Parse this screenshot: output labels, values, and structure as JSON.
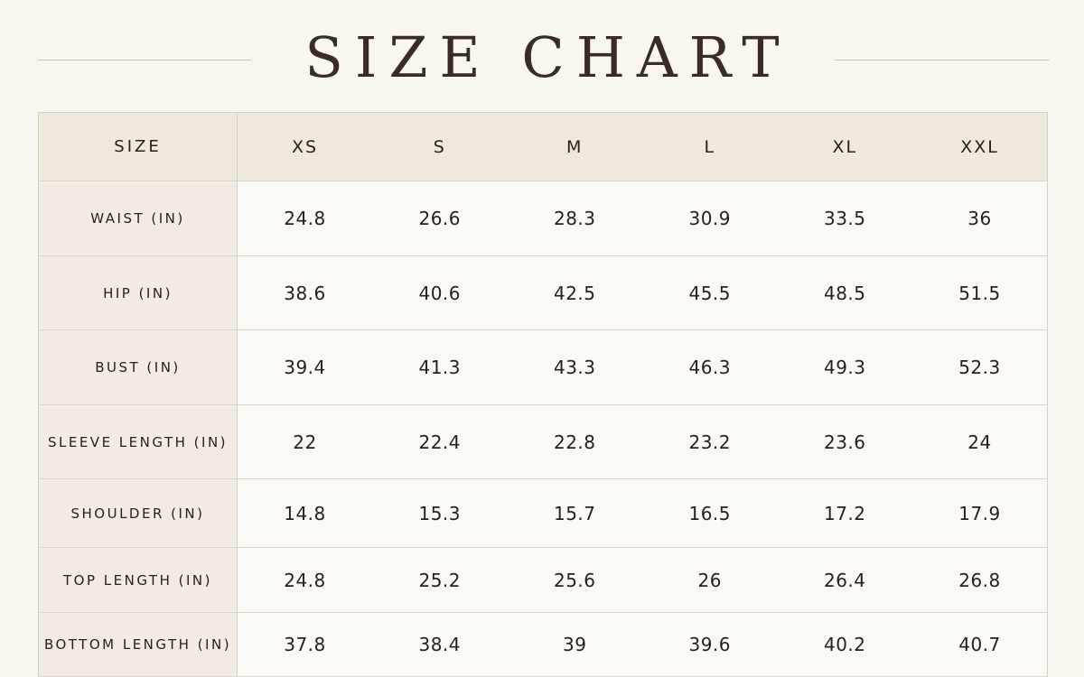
{
  "title": "SIZE CHART",
  "table": {
    "header_label": "SIZE",
    "sizes": [
      "XS",
      "S",
      "M",
      "L",
      "XL",
      "XXL"
    ],
    "rows": [
      {
        "label": "WAIST (IN)",
        "values": [
          "24.8",
          "26.6",
          "28.3",
          "30.9",
          "33.5",
          "36"
        ]
      },
      {
        "label": "HIP (IN)",
        "values": [
          "38.6",
          "40.6",
          "42.5",
          "45.5",
          "48.5",
          "51.5"
        ]
      },
      {
        "label": "BUST (IN)",
        "values": [
          "39.4",
          "41.3",
          "43.3",
          "46.3",
          "49.3",
          "52.3"
        ]
      },
      {
        "label": "SLEEVE LENGTH (IN)",
        "values": [
          "22",
          "22.4",
          "22.8",
          "23.2",
          "23.6",
          "24"
        ]
      },
      {
        "label": "SHOULDER (IN)",
        "values": [
          "14.8",
          "15.3",
          "15.7",
          "16.5",
          "17.2",
          "17.9"
        ]
      },
      {
        "label": "TOP LENGTH (IN)",
        "values": [
          "24.8",
          "25.2",
          "25.6",
          "26",
          "26.4",
          "26.8"
        ]
      },
      {
        "label": "BOTTOM LENGTH (IN)",
        "values": [
          "37.8",
          "38.4",
          "39",
          "39.6",
          "40.2",
          "40.7"
        ]
      }
    ]
  },
  "colors": {
    "background": "#f9f6f0",
    "header_background": "#efe8dd",
    "label_background": "#f1ebe3",
    "text": "#2a201a",
    "rule": "#c9bfb3"
  }
}
